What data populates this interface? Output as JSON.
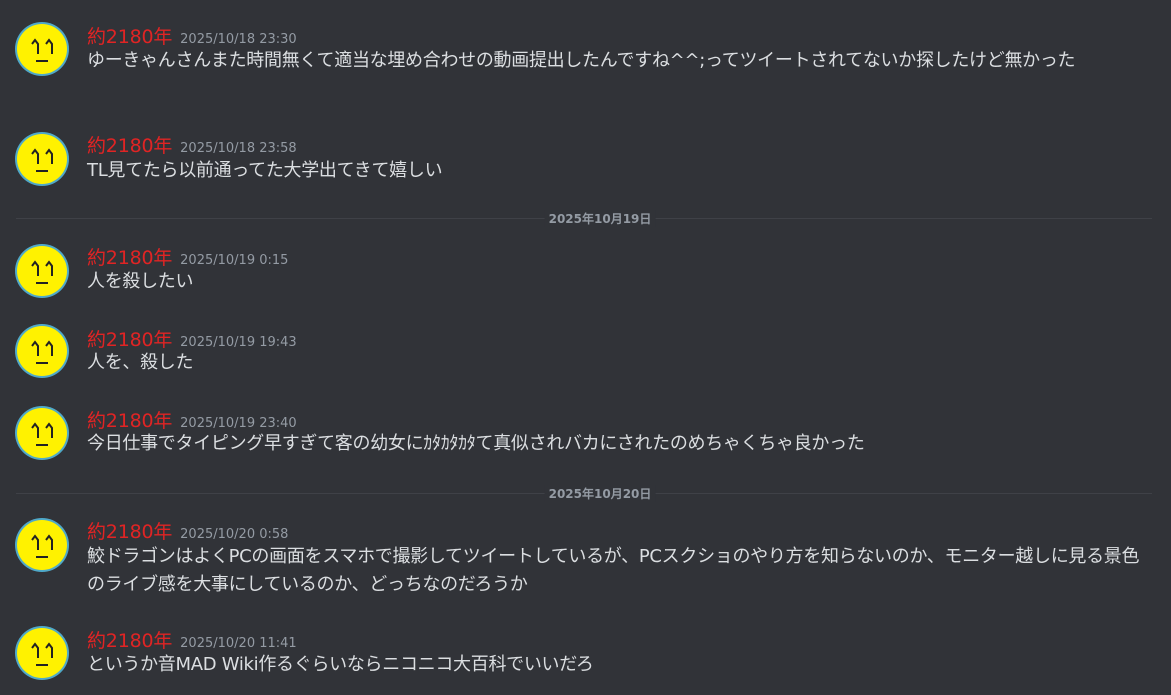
{
  "messages": [
    {
      "author": "約2180年",
      "time": "2025/10/18 23:30",
      "text": "ゆーきゃんさんまた時間無くて適当な埋め合わせの動画提出したんですね^^;ってツイートされてないか探したけど無かった"
    },
    {
      "author": "約2180年",
      "time": "2025/10/18 23:58",
      "text": "TL見てたら以前通ってた大学出てきて嬉しい"
    },
    {
      "author": "約2180年",
      "time": "2025/10/19 0:15",
      "text": "人を殺したい"
    },
    {
      "author": "約2180年",
      "time": "2025/10/19 19:43",
      "text": "人を、殺した"
    },
    {
      "author": "約2180年",
      "time": "2025/10/19 23:40",
      "text": "今日仕事でタイピング早すぎて客の幼女にｶﾀｶﾀｶﾀて真似されバカにされたのめちゃくちゃ良かった"
    },
    {
      "author": "約2180年",
      "time": "2025/10/20 0:58",
      "text": "鮫ドラゴンはよくPCの画面をスマホで撮影してツイートしているが、PCスクショのやり方を知らないのか、モニター越しに見る景色のライブ感を大事にしているのか、どっちなのだろうか"
    },
    {
      "author": "約2180年",
      "time": "2025/10/20 11:41",
      "text": "というか音MAD Wiki作るぐらいならニコニコ大百科でいいだろ"
    }
  ],
  "dividers": [
    {
      "label": "2025年10月19日"
    },
    {
      "label": "2025年10月20日"
    }
  ],
  "colors": {
    "background": "#313338",
    "author": "#e02424",
    "timestamp": "#949ba4",
    "text": "#dbdee1",
    "avatar_face": "#fff200",
    "avatar_ring": "#4fa9c9"
  },
  "icons": {
    "avatar": "yellow-angry-face-icon"
  }
}
